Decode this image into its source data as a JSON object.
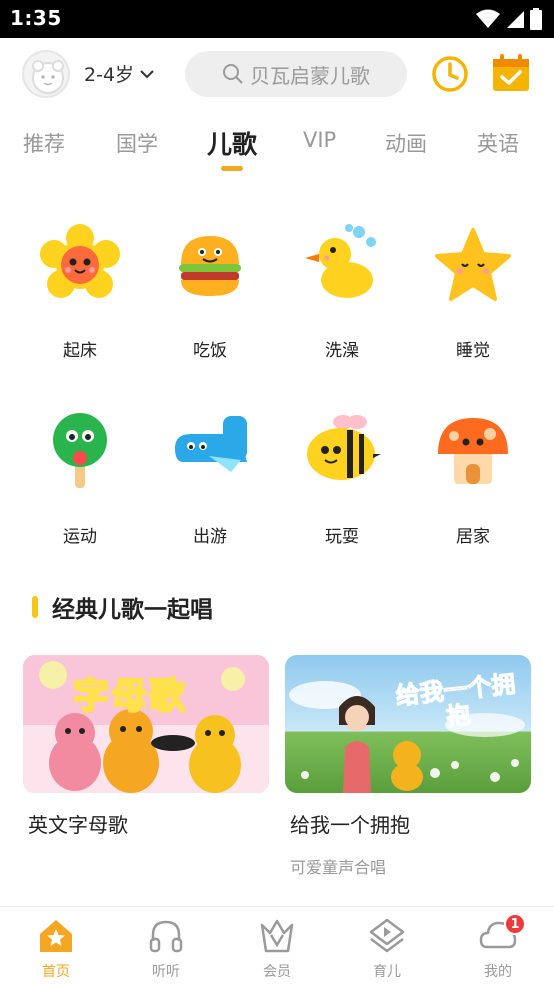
{
  "status_bar": {
    "time": "1:35"
  },
  "header": {
    "age_label": "2-4岁",
    "search_placeholder": "贝瓦启蒙儿歌"
  },
  "tabs": [
    {
      "label": "推荐"
    },
    {
      "label": "国学"
    },
    {
      "label": "儿歌"
    },
    {
      "label": "VIP"
    },
    {
      "label": "动画"
    },
    {
      "label": "英语"
    }
  ],
  "categories": [
    {
      "label": "起床",
      "icon": "sun-icon"
    },
    {
      "label": "吃饭",
      "icon": "burger-icon"
    },
    {
      "label": "洗澡",
      "icon": "duck-icon"
    },
    {
      "label": "睡觉",
      "icon": "star-icon"
    },
    {
      "label": "运动",
      "icon": "ping-pong-paddle-icon"
    },
    {
      "label": "出游",
      "icon": "airplane-icon"
    },
    {
      "label": "玩耍",
      "icon": "bee-icon"
    },
    {
      "label": "居家",
      "icon": "mushroom-house-icon"
    }
  ],
  "section": {
    "title": "经典儿歌一起唱"
  },
  "cards": [
    {
      "title": "英文字母歌",
      "subtitle": "",
      "image_text": "字母歌"
    },
    {
      "title": "给我一个拥抱",
      "subtitle": "可爱童声合唱",
      "image_text": "给我一个拥抱"
    }
  ],
  "bottom_nav": [
    {
      "label": "首页",
      "active": true
    },
    {
      "label": "听听"
    },
    {
      "label": "会员"
    },
    {
      "label": "育儿"
    },
    {
      "label": "我的",
      "badge": "1"
    }
  ],
  "colors": {
    "accent": "#f5a623",
    "badge": "#ee3a3a",
    "section_bar": "#f5c518"
  }
}
